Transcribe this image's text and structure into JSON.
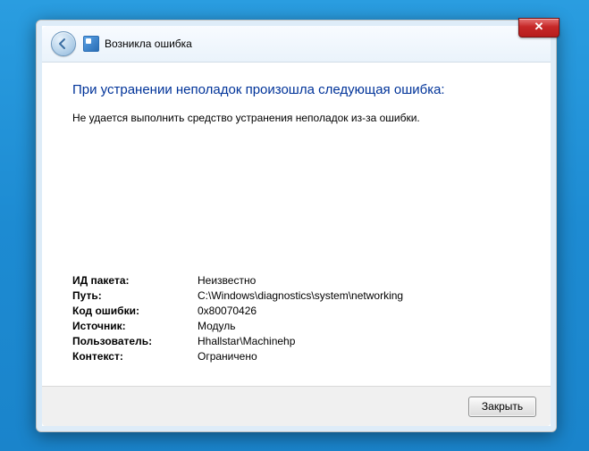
{
  "window": {
    "title": "Возникла ошибка",
    "heading": "При устранении неполадок произошла следующая ошибка:",
    "subtext": "Не удается выполнить средство устранения неполадок из-за ошибки."
  },
  "details": [
    {
      "label": "ИД пакета:",
      "value": "Неизвестно"
    },
    {
      "label": "Путь:",
      "value": "C:\\Windows\\diagnostics\\system\\networking"
    },
    {
      "label": "Код ошибки:",
      "value": "0x80070426"
    },
    {
      "label": "Источник:",
      "value": "Модуль"
    },
    {
      "label": "Пользователь:",
      "value": "Hhallstar\\Machinehp"
    },
    {
      "label": "Контекст:",
      "value": "Ограничено"
    }
  ],
  "buttons": {
    "close_window_glyph": "✕",
    "close_label": "Закрыть"
  }
}
